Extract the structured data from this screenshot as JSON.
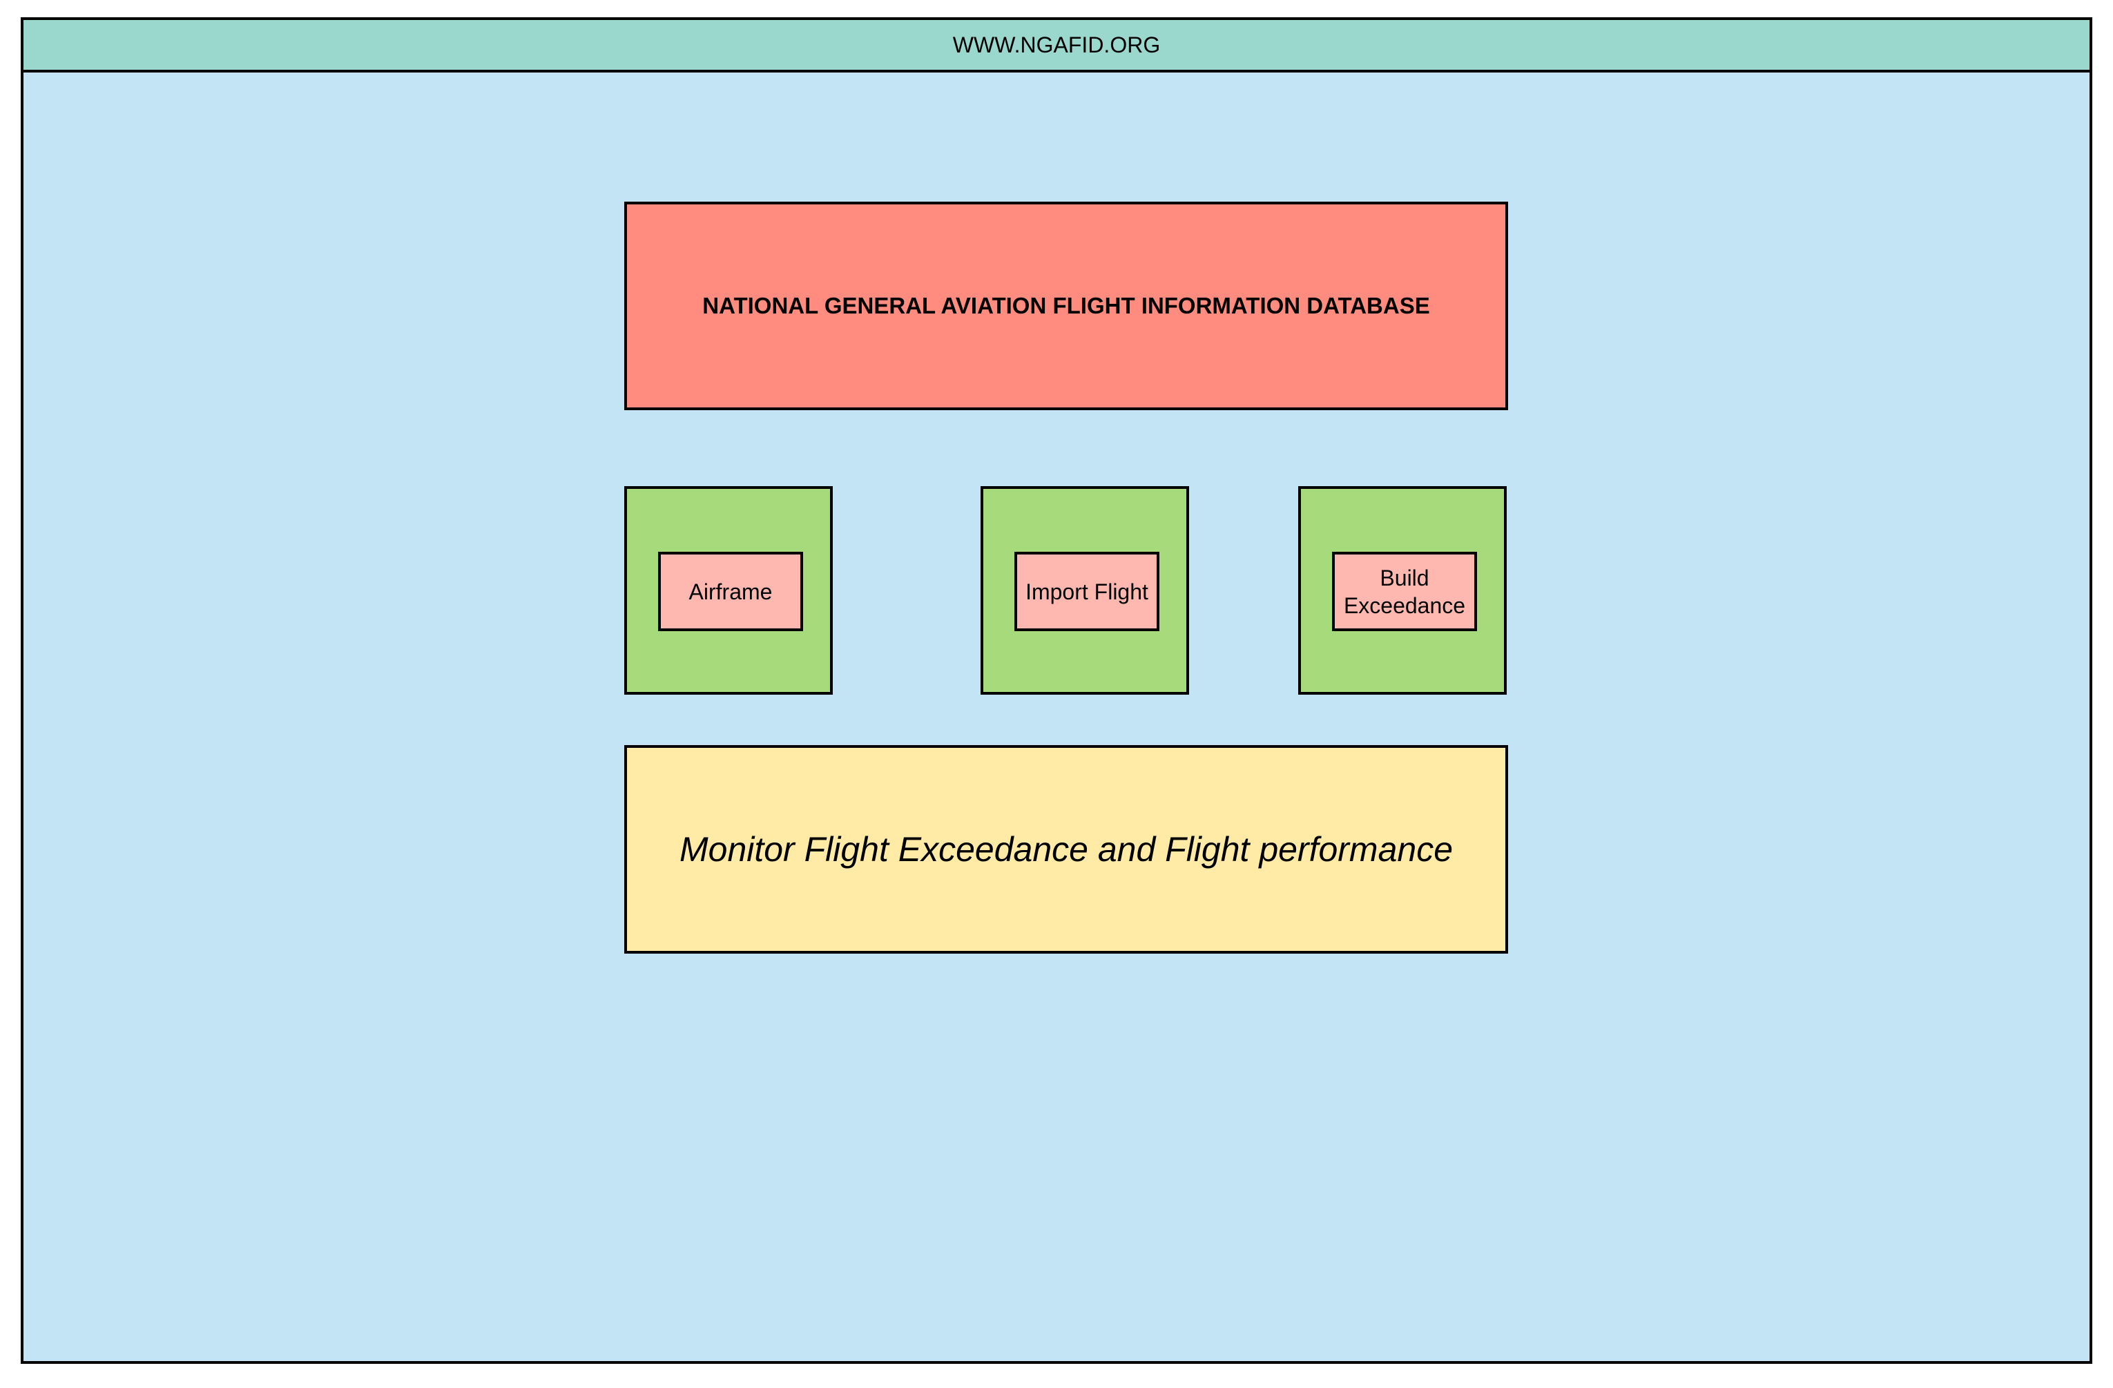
{
  "header": {
    "url": "WWW.NGAFID.ORG"
  },
  "title_box": {
    "text": "NATIONAL GENERAL AVIATION FLIGHT INFORMATION DATABASE"
  },
  "modules": [
    {
      "label": "Airframe"
    },
    {
      "label": "Import Flight"
    },
    {
      "label_line1": "Build",
      "label_line2": "Exceedance"
    }
  ],
  "monitor_box": {
    "text": "Monitor Flight Exceedance and Flight performance"
  },
  "colors": {
    "frame_background": "#c3e4f5",
    "header_background": "#9ad7cc",
    "title_background": "#ff8c7e",
    "module_background": "#a6da7a",
    "button_background": "#ffb8b0",
    "monitor_background": "#ffeaa6"
  }
}
